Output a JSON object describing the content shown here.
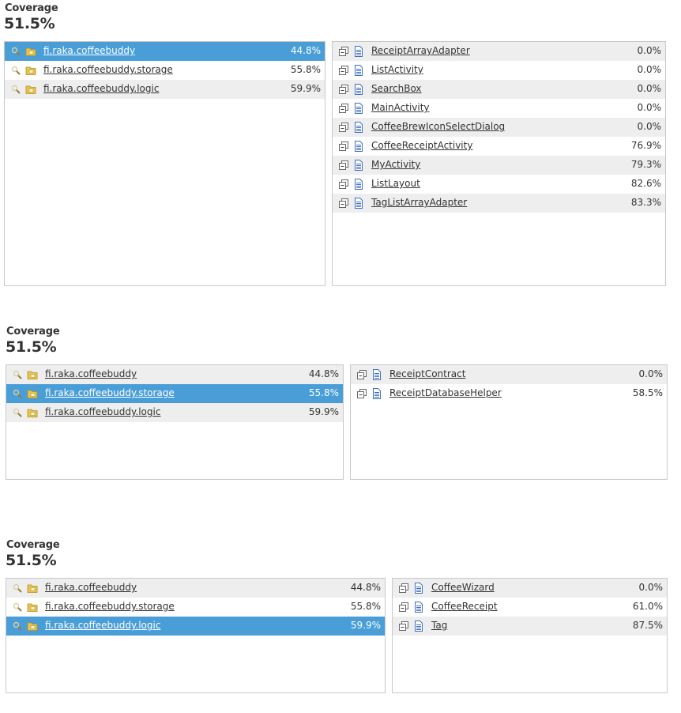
{
  "sections": [
    {
      "coverage_label": "Coverage",
      "coverage_value": "51.5%",
      "packages": [
        {
          "name": "fi.raka.coffeebuddy",
          "pct": "44.8%",
          "selected": true
        },
        {
          "name": "fi.raka.coffeebuddy.storage",
          "pct": "55.8%"
        },
        {
          "name": "fi.raka.coffeebuddy.logic",
          "pct": "59.9%"
        }
      ],
      "classes": [
        {
          "name": "ReceiptArrayAdapter",
          "pct": "0.0%"
        },
        {
          "name": "ListActivity",
          "pct": "0.0%"
        },
        {
          "name": "SearchBox",
          "pct": "0.0%"
        },
        {
          "name": "MainActivity",
          "pct": "0.0%"
        },
        {
          "name": "CoffeeBrewIconSelectDialog",
          "pct": "0.0%"
        },
        {
          "name": "CoffeeReceiptActivity",
          "pct": "76.9%"
        },
        {
          "name": "MyActivity",
          "pct": "79.3%"
        },
        {
          "name": "ListLayout",
          "pct": "82.6%"
        },
        {
          "name": "TagListArrayAdapter",
          "pct": "83.3%"
        }
      ]
    },
    {
      "coverage_label": "Coverage",
      "coverage_value": "51.5%",
      "packages": [
        {
          "name": "fi.raka.coffeebuddy",
          "pct": "44.8%"
        },
        {
          "name": "fi.raka.coffeebuddy.storage",
          "pct": "55.8%",
          "selected": true
        },
        {
          "name": "fi.raka.coffeebuddy.logic",
          "pct": "59.9%"
        }
      ],
      "classes": [
        {
          "name": "ReceiptContract",
          "pct": "0.0%"
        },
        {
          "name": "ReceiptDatabaseHelper",
          "pct": "58.5%"
        }
      ]
    },
    {
      "coverage_label": "Coverage",
      "coverage_value": "51.5%",
      "packages": [
        {
          "name": "fi.raka.coffeebuddy",
          "pct": "44.8%"
        },
        {
          "name": "fi.raka.coffeebuddy.storage",
          "pct": "55.8%"
        },
        {
          "name": "fi.raka.coffeebuddy.logic",
          "pct": "59.9%",
          "selected": true
        }
      ],
      "classes": [
        {
          "name": "CoffeeWizard",
          "pct": "0.0%"
        },
        {
          "name": "CoffeeReceipt",
          "pct": "61.0%"
        },
        {
          "name": "Tag",
          "pct": "87.5%"
        }
      ]
    }
  ],
  "colors": {
    "selected_row": "#4a9ed7",
    "alt_row": "#eeeeee",
    "border": "#c8c8c8",
    "folder_icon": "#e8c550",
    "file_icon": "#3f6fc1"
  },
  "icons": {
    "package_leading": "magnifier-icon",
    "package_type": "package-folder-icon",
    "class_leading": "expand-class-icon",
    "class_type": "class-file-icon"
  }
}
